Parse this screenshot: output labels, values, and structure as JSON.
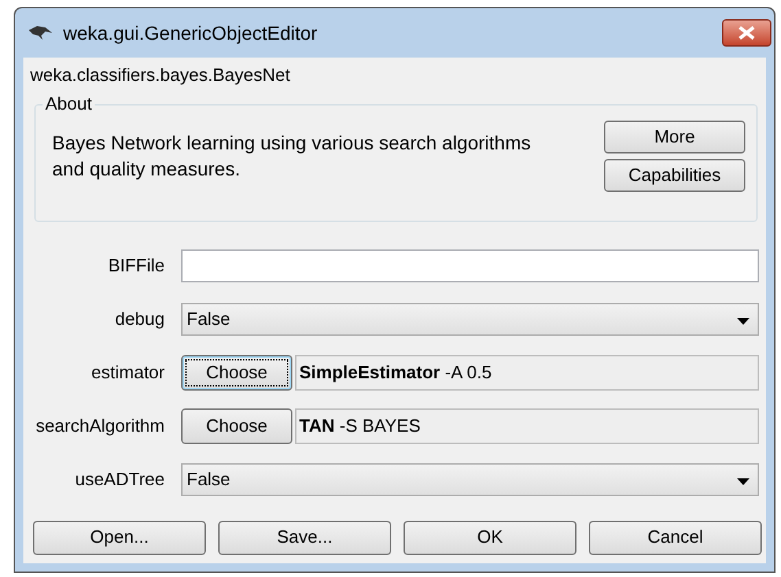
{
  "window": {
    "title": "weka.gui.GenericObjectEditor"
  },
  "class_name": "weka.classifiers.bayes.BayesNet",
  "about": {
    "title": "About",
    "description": "Bayes Network learning using various search algorithms and quality measures.",
    "buttons": [
      "More",
      "Capabilities"
    ]
  },
  "properties": [
    {
      "label": "BIFFile",
      "kind": "text"
    },
    {
      "label": "debug",
      "kind": "select",
      "value": "False"
    },
    {
      "label": "estimator",
      "kind": "object",
      "button": "Choose",
      "focused": true,
      "value": "**SimpleEstimator** -A 0.5"
    },
    {
      "label": "searchAlgorithm",
      "kind": "object",
      "button": "Choose",
      "focused": false,
      "value": "**TAN** -S BAYES"
    },
    {
      "label": "useADTree",
      "kind": "select",
      "value": "False"
    }
  ],
  "buttons": [
    "Open...",
    "Save...",
    "OK",
    "Cancel"
  ]
}
